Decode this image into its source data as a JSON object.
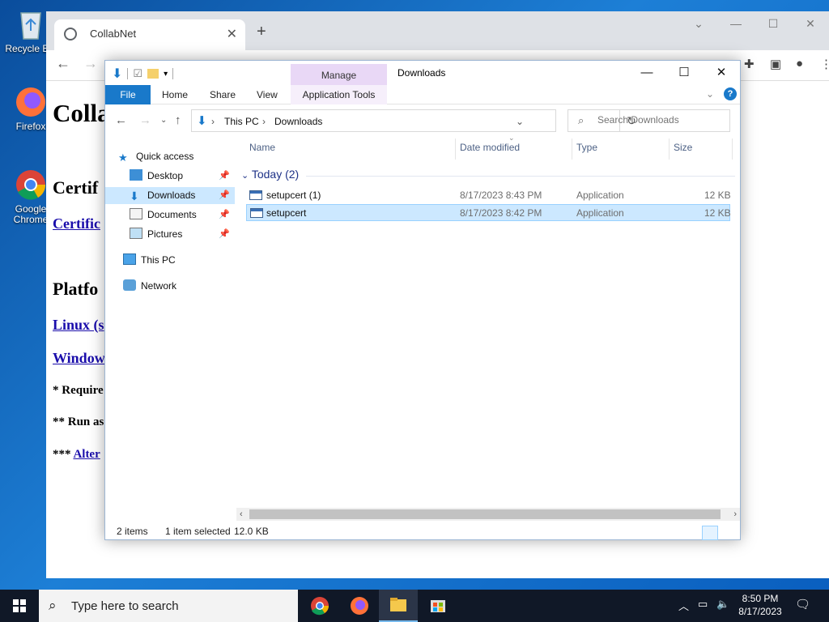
{
  "desktop": {
    "icons": [
      {
        "label": "Recycle Bin",
        "icon": "recycle-bin-icon"
      },
      {
        "label": "Firefox",
        "icon": "firefox-icon"
      },
      {
        "label": "Google Chrome",
        "icon": "chrome-icon"
      }
    ]
  },
  "browser": {
    "tab_title": "CollabNet",
    "page": {
      "heading": "Colla",
      "cert_heading": "Certif",
      "cert_link": "Certific",
      "platform_heading": "Platfo",
      "linux_link": "Linux (s",
      "windows_link": "Window",
      "note1": "* Require",
      "note2": "** Run as",
      "note3_prefix": "*** ",
      "note3_link": "Alter"
    }
  },
  "explorer": {
    "title": "Downloads",
    "manage_label": "Manage",
    "ribbon_tabs": [
      "File",
      "Home",
      "Share",
      "View",
      "Application Tools"
    ],
    "breadcrumb": [
      "This PC",
      "Downloads"
    ],
    "search_placeholder": "Search Downloads",
    "nav": {
      "quick_access": "Quick access",
      "items": [
        "Desktop",
        "Downloads",
        "Documents",
        "Pictures"
      ],
      "this_pc": "This PC",
      "network": "Network"
    },
    "columns": [
      "Name",
      "Date modified",
      "Type",
      "Size"
    ],
    "group_label": "Today (2)",
    "files": [
      {
        "name": "setupcert (1)",
        "date": "8/17/2023 8:43 PM",
        "type": "Application",
        "size": "12 KB"
      },
      {
        "name": "setupcert",
        "date": "8/17/2023 8:42 PM",
        "type": "Application",
        "size": "12 KB"
      }
    ],
    "status": {
      "items": "2 items",
      "selected": "1 item selected",
      "size": "12.0 KB"
    }
  },
  "taskbar": {
    "search_placeholder": "Type here to search",
    "time": "8:50 PM",
    "date": "8/17/2023"
  },
  "colors": {
    "accent": "#1979ca",
    "selection": "#cce8ff",
    "manage_tab": "#e9d8f6",
    "taskbar": "#101827"
  }
}
